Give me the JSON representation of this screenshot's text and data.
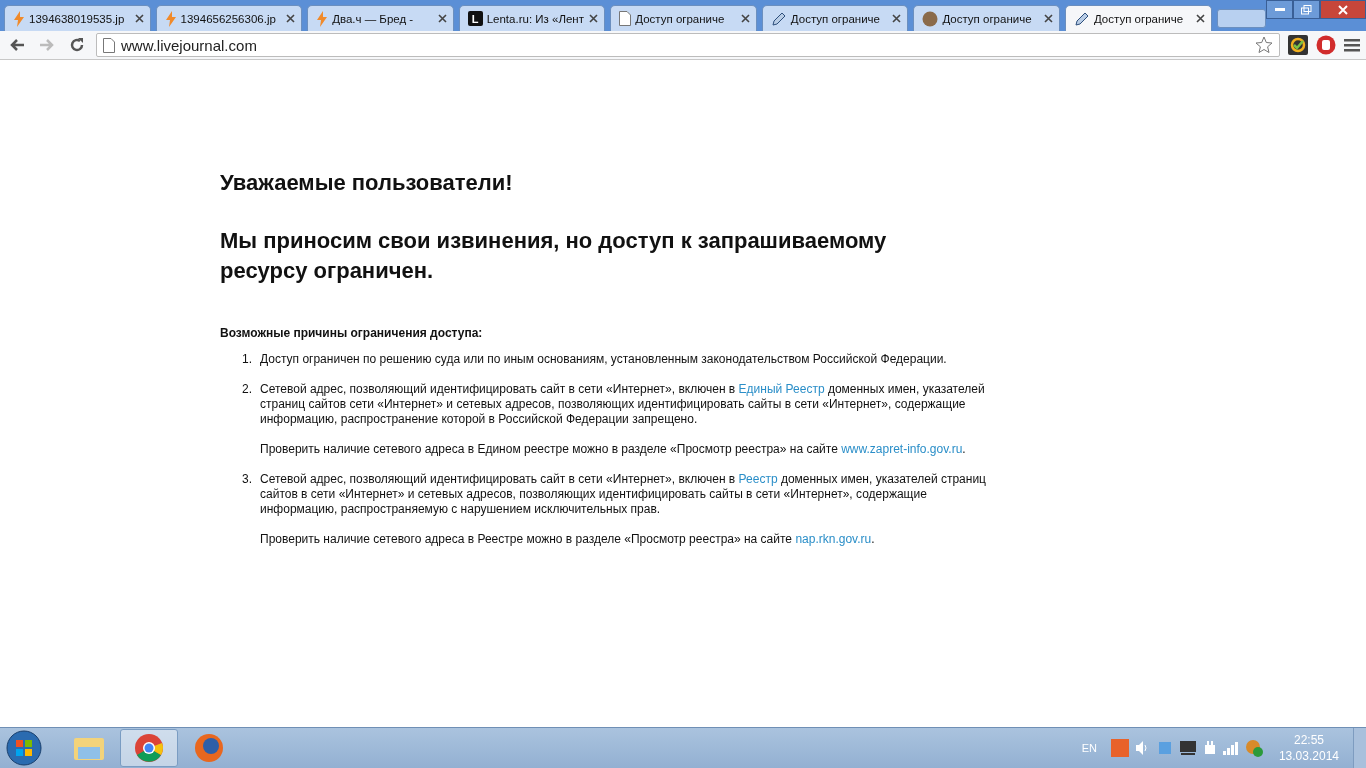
{
  "tabs": [
    {
      "title": "1394638019535.jp",
      "kind": "bolt",
      "selected": false
    },
    {
      "title": "1394656256306.jp",
      "kind": "bolt",
      "selected": false
    },
    {
      "title": "Два.ч — Бред -",
      "kind": "bolt",
      "selected": false
    },
    {
      "title": "Lenta.ru: Из «Лент",
      "kind": "letter",
      "icon_text": "L",
      "selected": false
    },
    {
      "title": "Доступ ограниче",
      "kind": "page",
      "selected": false
    },
    {
      "title": "Доступ ограниче",
      "kind": "pencil",
      "selected": false
    },
    {
      "title": "Доступ ограниче",
      "kind": "avatar",
      "selected": false
    },
    {
      "title": "Доступ ограниче",
      "kind": "pencil",
      "selected": true
    }
  ],
  "address": {
    "value": "www.livejournal.com"
  },
  "page": {
    "greeting": "Уважаемые пользователи!",
    "apology": "Мы приносим свои извинения, но доступ к запрашиваемому ресурсу ограничен.",
    "reasons_title": "Возможные причины ограничения доступа:",
    "reasons": [
      {
        "number": "1.",
        "paragraphs": [
          [
            {
              "text": "Доступ ограничен  по решению суда или по иным основаниям, установленным законодательством Российской Федерации."
            }
          ]
        ]
      },
      {
        "number": "2.",
        "paragraphs": [
          [
            {
              "text": "Сетевой адрес, позволяющий идентифицировать сайт в сети «Интернет», включен в "
            },
            {
              "text": "Единый Реестр",
              "kind": "link"
            },
            {
              "text": " доменных имен, указателей страниц сайтов сети «Интернет» и сетевых адресов, позволяющих идентифицировать сайты в сети «Интернет», содержащие информацию, распространение которой в Российской Федерации запрещено."
            }
          ],
          [
            {
              "text": "Проверить наличие сетевого адреса в Едином реестре можно в разделе «Просмотр реестра» на сайте "
            },
            {
              "text": "www.zapret-info.gov.ru",
              "kind": "link"
            },
            {
              "text": "."
            }
          ]
        ]
      },
      {
        "number": "3.",
        "paragraphs": [
          [
            {
              "text": "Сетевой адрес, позволяющий идентифицировать сайт в сети «Интернет», включен в "
            },
            {
              "text": "Реестр",
              "kind": "link"
            },
            {
              "text": " доменных имен, указателей страниц сайтов в сети «Интернет» и сетевых адресов, позволяющих идентифицировать сайты в сети «Интернет», содержащие информацию, распространяемую с нарушением исключительных прав."
            }
          ],
          [
            {
              "text": "Проверить наличие сетевого адреса в Реестре можно в разделе «Просмотр реестра» на сайте "
            },
            {
              "text": "nap.rkn.gov.ru",
              "kind": "link"
            },
            {
              "text": "."
            }
          ]
        ]
      }
    ]
  },
  "taskbar": {
    "apps": [
      {
        "kind": "folder",
        "selected": false
      },
      {
        "kind": "chrome",
        "selected": true
      },
      {
        "kind": "firefox",
        "selected": false
      }
    ],
    "language": "EN",
    "time": "22:55",
    "date": "13.03.2014"
  }
}
